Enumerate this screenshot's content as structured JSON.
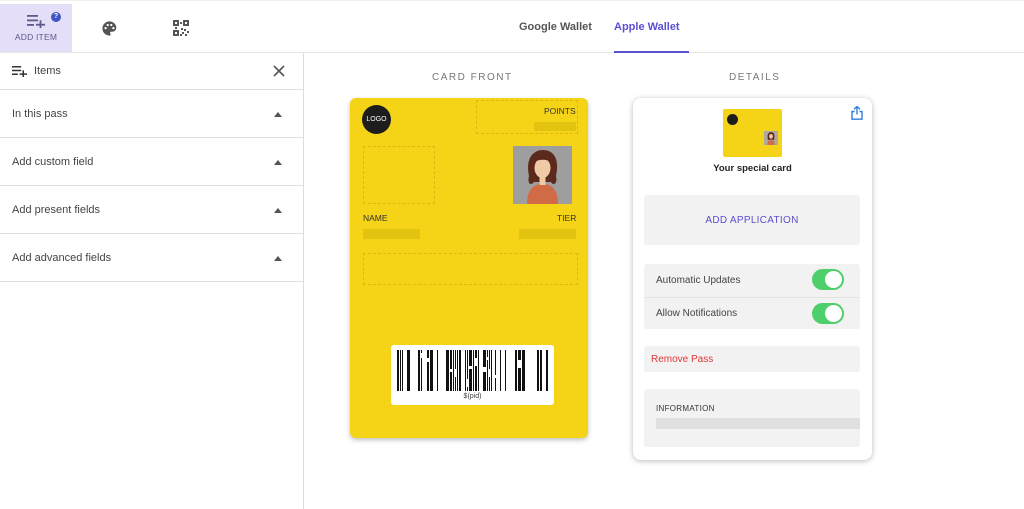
{
  "toolbar": {
    "add_item": {
      "label": "ADD ITEM",
      "icon": "playlist-add-icon",
      "badge_icon": "help-badge-icon"
    },
    "palette": {
      "icon": "palette-icon"
    },
    "qr": {
      "icon": "qr-code-icon"
    }
  },
  "tabs": [
    {
      "label": "Google Wallet",
      "active": false
    },
    {
      "label": "Apple Wallet",
      "active": true
    }
  ],
  "sidebar": {
    "title": "Items",
    "sections": [
      {
        "label": "In this pass"
      },
      {
        "label": "Add custom field"
      },
      {
        "label": "Add present fields"
      },
      {
        "label": "Add advanced fields"
      }
    ]
  },
  "main": {
    "card_front_label": "CARD FRONT",
    "details_label": "DETAILS"
  },
  "card": {
    "logo": "LOGO",
    "points_label": "POINTS",
    "name_label": "NAME",
    "tier_label": "TIER",
    "barcode_text": "$(pid)",
    "background_color": "#f5d417"
  },
  "details": {
    "card_name": "Your special card",
    "add_application": "ADD APPLICATION",
    "toggles": [
      {
        "label": "Automatic Updates",
        "on": true
      },
      {
        "label": "Allow Notifications",
        "on": true
      }
    ],
    "remove_pass": "Remove Pass",
    "information_label": "INFORMATION"
  },
  "colors": {
    "accent": "#5a4fd0",
    "toggle_on": "#4fcf6b",
    "danger": "#e0383a"
  }
}
